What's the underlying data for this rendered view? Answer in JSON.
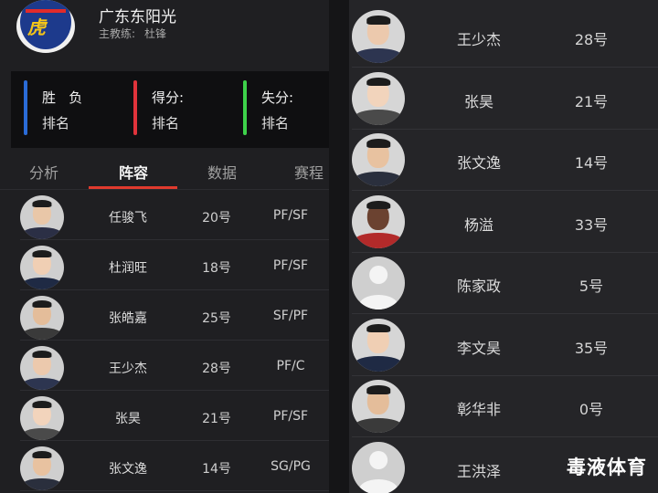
{
  "team": {
    "name": "广东东阳光",
    "coach_label": "主教练:",
    "coach_name": "杜锋"
  },
  "stats": [
    {
      "line1": "胜   负",
      "line2": "排名",
      "color": "#2a6cd8"
    },
    {
      "line1": "得分:",
      "line2": "排名",
      "color": "#e0333b"
    },
    {
      "line1": "失分:",
      "line2": "排名",
      "color": "#3ed24a"
    }
  ],
  "tabs": [
    {
      "label": "分析",
      "active": false
    },
    {
      "label": "阵容",
      "active": true
    },
    {
      "label": "数据",
      "active": false
    },
    {
      "label": "赛程",
      "active": false
    }
  ],
  "roster_left": [
    {
      "name": "任骏飞",
      "number": "20号",
      "position": "PF/SF"
    },
    {
      "name": "杜润旺",
      "number": "18号",
      "position": "PF/SF"
    },
    {
      "name": "张皓嘉",
      "number": "25号",
      "position": "SF/PF"
    },
    {
      "name": "王少杰",
      "number": "28号",
      "position": "PF/C"
    },
    {
      "name": "张昊",
      "number": "21号",
      "position": "PF/SF"
    },
    {
      "name": "张文逸",
      "number": "14号",
      "position": "SG/PG"
    }
  ],
  "roster_right": [
    {
      "name": "王少杰",
      "number": "28号",
      "avatar": "photo"
    },
    {
      "name": "张昊",
      "number": "21号",
      "avatar": "photo"
    },
    {
      "name": "张文逸",
      "number": "14号",
      "avatar": "photo"
    },
    {
      "name": "杨溢",
      "number": "33号",
      "avatar": "photo"
    },
    {
      "name": "陈家政",
      "number": "5号",
      "avatar": "placeholder"
    },
    {
      "name": "李文昊",
      "number": "35号",
      "avatar": "photo"
    },
    {
      "name": "彰华非",
      "number": "0号",
      "avatar": "photo"
    },
    {
      "name": "王洪泽",
      "number": "",
      "avatar": "placeholder"
    }
  ],
  "watermark": "毒液体育",
  "colors": {
    "tab_active_underline": "#e03a2e",
    "background": "#1f1f22"
  }
}
